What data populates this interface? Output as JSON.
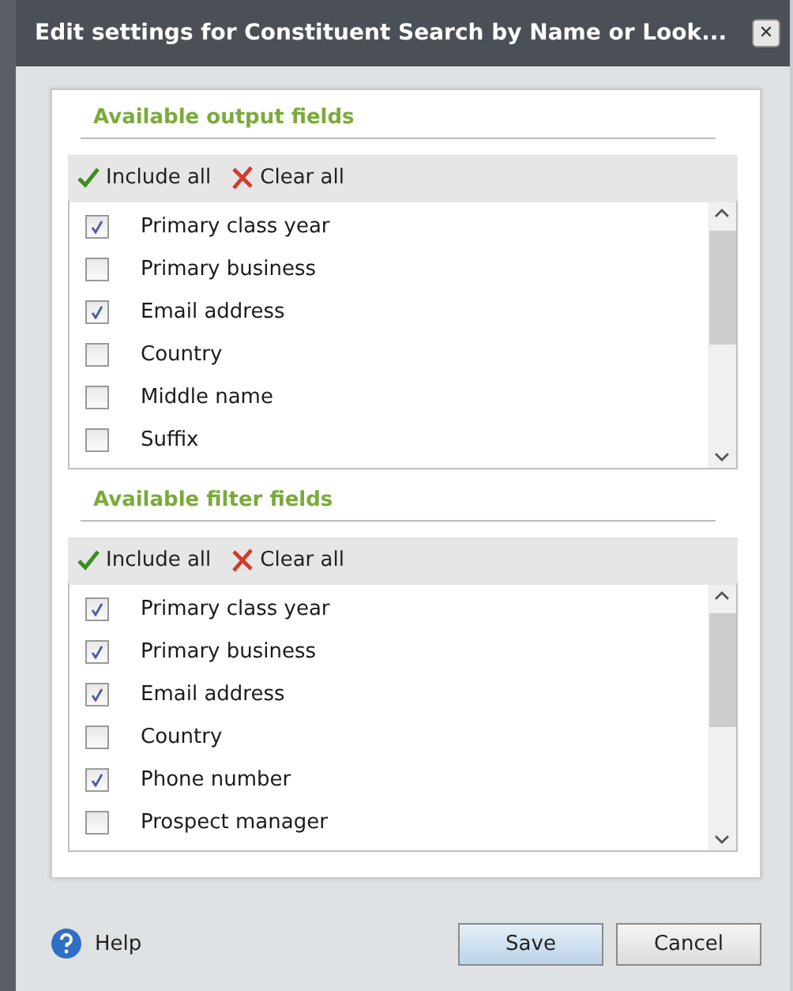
{
  "window": {
    "title": "Edit settings for Constituent Search by Name or Look...",
    "close": "✕"
  },
  "sections": [
    {
      "heading": "Available output fields",
      "include_all": "Include all",
      "clear_all": "Clear all",
      "items": [
        {
          "label": "Primary class year",
          "checked": true
        },
        {
          "label": "Primary business",
          "checked": false
        },
        {
          "label": "Email address",
          "checked": true
        },
        {
          "label": "Country",
          "checked": false
        },
        {
          "label": "Middle name",
          "checked": false
        },
        {
          "label": "Suffix",
          "checked": false
        }
      ]
    },
    {
      "heading": "Available filter fields",
      "include_all": "Include all",
      "clear_all": "Clear all",
      "items": [
        {
          "label": "Primary class year",
          "checked": true
        },
        {
          "label": "Primary business",
          "checked": true
        },
        {
          "label": "Email address",
          "checked": true
        },
        {
          "label": "Country",
          "checked": false
        },
        {
          "label": "Phone number",
          "checked": true
        },
        {
          "label": "Prospect manager",
          "checked": false
        }
      ]
    }
  ],
  "footer": {
    "help": "Help",
    "buttons": [
      "Save",
      "Cancel"
    ]
  }
}
